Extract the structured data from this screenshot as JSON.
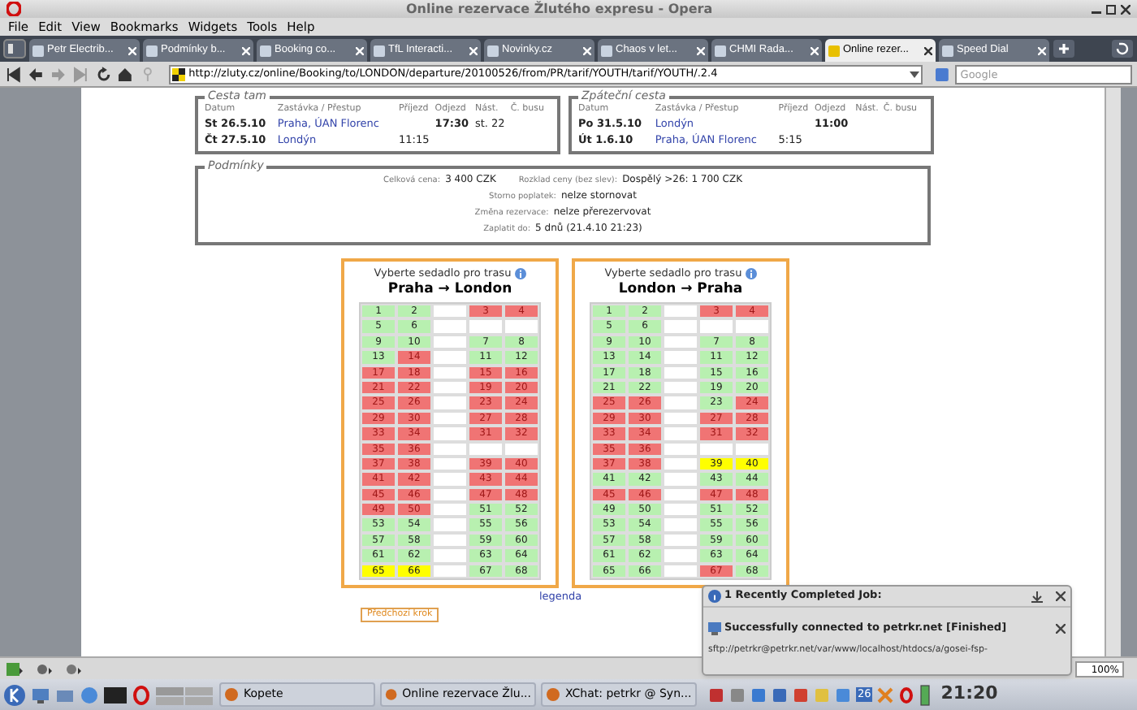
{
  "window": {
    "title": "Online rezervace Žlutého expresu - Opera"
  },
  "menu": [
    "File",
    "Edit",
    "View",
    "Bookmarks",
    "Widgets",
    "Tools",
    "Help"
  ],
  "tabs": [
    {
      "label": "Petr Electrib...",
      "selected": false
    },
    {
      "label": "Podmínky b...",
      "selected": false
    },
    {
      "label": "Booking co...",
      "selected": false
    },
    {
      "label": "TfL Interacti...",
      "selected": false
    },
    {
      "label": "Novinky.cz",
      "selected": false
    },
    {
      "label": "Chaos v let...",
      "selected": false
    },
    {
      "label": "CHMI Rada...",
      "selected": false
    },
    {
      "label": "Online rezer...",
      "selected": true
    },
    {
      "label": "Speed Dial",
      "selected": false
    }
  ],
  "address_bar": {
    "url": "http://zluty.cz/online/Booking/to/LONDON/departure/20100526/from/PR/tarif/YOUTH/tarif/YOUTH/.2.4"
  },
  "search": {
    "placeholder": "Google"
  },
  "trips": [
    {
      "title": "Cesta tam",
      "columns": [
        "Datum",
        "Zastávka / Přestup",
        "Příjezd",
        "Odjezd",
        "Nást.",
        "Č. busu"
      ],
      "rows": [
        {
          "date": "St 26.5.10",
          "stop": "Praha, ÚAN Florenc",
          "departure": "17:30",
          "platform": "st. 22"
        },
        {
          "date": "Čt 27.5.10",
          "stop": "Londýn",
          "arrival": "11:15"
        }
      ]
    },
    {
      "title": "Zpáteční cesta",
      "columns": [
        "Datum",
        "Zastávka / Přestup",
        "Příjezd",
        "Odjezd",
        "Nást.",
        "Č. busu"
      ],
      "rows": [
        {
          "date": "Po 31.5.10",
          "stop": "Londýn",
          "departure": "11:00"
        },
        {
          "date": "Út 1.6.10",
          "stop": "Praha, ÚAN Florenc",
          "arrival": "5:15"
        }
      ]
    }
  ],
  "conditions": {
    "title": "Podmínky",
    "lines": [
      [
        {
          "label": "Celková cena:",
          "value": "3 400 CZK"
        },
        {
          "label": "Rozklad ceny (bez slev):",
          "value": "Dospělý >26: 1 700 CZK"
        }
      ],
      [
        {
          "label": "Storno poplatek:",
          "value": "nelze stornovat"
        }
      ],
      [
        {
          "label": "Změna rezervace:",
          "value": "nelze přerezervovat"
        }
      ],
      [
        {
          "label": "Zaplatit do:",
          "value": "5 dnů (21.4.10 21:23)"
        }
      ]
    ]
  },
  "seat_maps": [
    {
      "heading": "Vyberte sedadlo pro trasu",
      "route": "Praha → London",
      "rows": [
        [
          {
            "kind": "seat",
            "number": "1",
            "taken": false,
            "selected": false
          },
          {
            "kind": "seat",
            "number": "2",
            "taken": false,
            "selected": false
          },
          {
            "kind": "seat",
            "number": "3",
            "taken": true,
            "selected": false
          },
          {
            "kind": "seat",
            "number": "4",
            "taken": true,
            "selected": false
          }
        ],
        [
          {
            "kind": "seat",
            "number": "5",
            "taken": false,
            "selected": false
          },
          {
            "kind": "seat",
            "number": "6",
            "taken": false,
            "selected": false
          },
          {
            "kind": "gap"
          },
          {
            "kind": "gap"
          }
        ],
        [
          {
            "kind": "seat",
            "number": "9",
            "taken": false,
            "selected": false
          },
          {
            "kind": "seat",
            "number": "10",
            "taken": false,
            "selected": false
          },
          {
            "kind": "seat",
            "number": "7",
            "taken": false,
            "selected": false
          },
          {
            "kind": "seat",
            "number": "8",
            "taken": false,
            "selected": false
          }
        ],
        [
          {
            "kind": "seat",
            "number": "13",
            "taken": false,
            "selected": false
          },
          {
            "kind": "seat",
            "number": "14",
            "taken": true,
            "selected": false
          },
          {
            "kind": "seat",
            "number": "11",
            "taken": false,
            "selected": false
          },
          {
            "kind": "seat",
            "number": "12",
            "taken": false,
            "selected": false
          }
        ],
        [
          {
            "kind": "seat",
            "number": "17",
            "taken": true,
            "selected": false
          },
          {
            "kind": "seat",
            "number": "18",
            "taken": true,
            "selected": false
          },
          {
            "kind": "seat",
            "number": "15",
            "taken": true,
            "selected": false
          },
          {
            "kind": "seat",
            "number": "16",
            "taken": true,
            "selected": false
          }
        ],
        [
          {
            "kind": "seat",
            "number": "21",
            "taken": true,
            "selected": false
          },
          {
            "kind": "seat",
            "number": "22",
            "taken": true,
            "selected": false
          },
          {
            "kind": "seat",
            "number": "19",
            "taken": true,
            "selected": false
          },
          {
            "kind": "seat",
            "number": "20",
            "taken": true,
            "selected": false
          }
        ],
        [
          {
            "kind": "seat",
            "number": "25",
            "taken": true,
            "selected": false
          },
          {
            "kind": "seat",
            "number": "26",
            "taken": true,
            "selected": false
          },
          {
            "kind": "seat",
            "number": "23",
            "taken": true,
            "selected": false
          },
          {
            "kind": "seat",
            "number": "24",
            "taken": true,
            "selected": false
          }
        ],
        [
          {
            "kind": "seat",
            "number": "29",
            "taken": true,
            "selected": false
          },
          {
            "kind": "seat",
            "number": "30",
            "taken": true,
            "selected": false
          },
          {
            "kind": "seat",
            "number": "27",
            "taken": true,
            "selected": false
          },
          {
            "kind": "seat",
            "number": "28",
            "taken": true,
            "selected": false
          }
        ],
        [
          {
            "kind": "seat",
            "number": "33",
            "taken": true,
            "selected": false
          },
          {
            "kind": "seat",
            "number": "34",
            "taken": true,
            "selected": false
          },
          {
            "kind": "seat",
            "number": "31",
            "taken": true,
            "selected": false
          },
          {
            "kind": "seat",
            "number": "32",
            "taken": true,
            "selected": false
          }
        ],
        [
          {
            "kind": "seat",
            "number": "35",
            "taken": true,
            "selected": false
          },
          {
            "kind": "seat",
            "number": "36",
            "taken": true,
            "selected": false
          },
          {
            "kind": "gap"
          },
          {
            "kind": "gap"
          }
        ],
        [
          {
            "kind": "seat",
            "number": "37",
            "taken": true,
            "selected": false
          },
          {
            "kind": "seat",
            "number": "38",
            "taken": true,
            "selected": false
          },
          {
            "kind": "seat",
            "number": "39",
            "taken": true,
            "selected": false
          },
          {
            "kind": "seat",
            "number": "40",
            "taken": true,
            "selected": false
          }
        ],
        [
          {
            "kind": "seat",
            "number": "41",
            "taken": true,
            "selected": false
          },
          {
            "kind": "seat",
            "number": "42",
            "taken": true,
            "selected": false
          },
          {
            "kind": "seat",
            "number": "43",
            "taken": true,
            "selected": false
          },
          {
            "kind": "seat",
            "number": "44",
            "taken": true,
            "selected": false
          }
        ],
        [
          {
            "kind": "seat",
            "number": "45",
            "taken": true,
            "selected": false
          },
          {
            "kind": "seat",
            "number": "46",
            "taken": true,
            "selected": false
          },
          {
            "kind": "seat",
            "number": "47",
            "taken": true,
            "selected": false
          },
          {
            "kind": "seat",
            "number": "48",
            "taken": true,
            "selected": false
          }
        ],
        [
          {
            "kind": "seat",
            "number": "49",
            "taken": true,
            "selected": false
          },
          {
            "kind": "seat",
            "number": "50",
            "taken": true,
            "selected": false
          },
          {
            "kind": "seat",
            "number": "51",
            "taken": false,
            "selected": false
          },
          {
            "kind": "seat",
            "number": "52",
            "taken": false,
            "selected": false
          }
        ],
        [
          {
            "kind": "seat",
            "number": "53",
            "taken": false,
            "selected": false
          },
          {
            "kind": "seat",
            "number": "54",
            "taken": false,
            "selected": false
          },
          {
            "kind": "seat",
            "number": "55",
            "taken": false,
            "selected": false
          },
          {
            "kind": "seat",
            "number": "56",
            "taken": false,
            "selected": false
          }
        ],
        [
          {
            "kind": "seat",
            "number": "57",
            "taken": false,
            "selected": false
          },
          {
            "kind": "seat",
            "number": "58",
            "taken": false,
            "selected": false
          },
          {
            "kind": "seat",
            "number": "59",
            "taken": false,
            "selected": false
          },
          {
            "kind": "seat",
            "number": "60",
            "taken": false,
            "selected": false
          }
        ],
        [
          {
            "kind": "seat",
            "number": "61",
            "taken": false,
            "selected": false
          },
          {
            "kind": "seat",
            "number": "62",
            "taken": false,
            "selected": false
          },
          {
            "kind": "seat",
            "number": "63",
            "taken": false,
            "selected": false
          },
          {
            "kind": "seat",
            "number": "64",
            "taken": false,
            "selected": false
          }
        ],
        [
          {
            "kind": "seat",
            "number": "65",
            "taken": false,
            "selected": true
          },
          {
            "kind": "seat",
            "number": "66",
            "taken": false,
            "selected": true
          },
          {
            "kind": "seat",
            "number": "67",
            "taken": false,
            "selected": false
          },
          {
            "kind": "seat",
            "number": "68",
            "taken": false,
            "selected": false
          }
        ]
      ]
    },
    {
      "heading": "Vyberte sedadlo pro trasu",
      "route": "London → Praha",
      "rows": [
        [
          {
            "kind": "seat",
            "number": "1",
            "taken": false,
            "selected": false
          },
          {
            "kind": "seat",
            "number": "2",
            "taken": false,
            "selected": false
          },
          {
            "kind": "seat",
            "number": "3",
            "taken": true,
            "selected": false
          },
          {
            "kind": "seat",
            "number": "4",
            "taken": true,
            "selected": false
          }
        ],
        [
          {
            "kind": "seat",
            "number": "5",
            "taken": false,
            "selected": false
          },
          {
            "kind": "seat",
            "number": "6",
            "taken": false,
            "selected": false
          },
          {
            "kind": "gap"
          },
          {
            "kind": "gap"
          }
        ],
        [
          {
            "kind": "seat",
            "number": "9",
            "taken": false,
            "selected": false
          },
          {
            "kind": "seat",
            "number": "10",
            "taken": false,
            "selected": false
          },
          {
            "kind": "seat",
            "number": "7",
            "taken": false,
            "selected": false
          },
          {
            "kind": "seat",
            "number": "8",
            "taken": false,
            "selected": false
          }
        ],
        [
          {
            "kind": "seat",
            "number": "13",
            "taken": false,
            "selected": false
          },
          {
            "kind": "seat",
            "number": "14",
            "taken": false,
            "selected": false
          },
          {
            "kind": "seat",
            "number": "11",
            "taken": false,
            "selected": false
          },
          {
            "kind": "seat",
            "number": "12",
            "taken": false,
            "selected": false
          }
        ],
        [
          {
            "kind": "seat",
            "number": "17",
            "taken": false,
            "selected": false
          },
          {
            "kind": "seat",
            "number": "18",
            "taken": false,
            "selected": false
          },
          {
            "kind": "seat",
            "number": "15",
            "taken": false,
            "selected": false
          },
          {
            "kind": "seat",
            "number": "16",
            "taken": false,
            "selected": false
          }
        ],
        [
          {
            "kind": "seat",
            "number": "21",
            "taken": false,
            "selected": false
          },
          {
            "kind": "seat",
            "number": "22",
            "taken": false,
            "selected": false
          },
          {
            "kind": "seat",
            "number": "19",
            "taken": false,
            "selected": false
          },
          {
            "kind": "seat",
            "number": "20",
            "taken": false,
            "selected": false
          }
        ],
        [
          {
            "kind": "seat",
            "number": "25",
            "taken": true,
            "selected": false
          },
          {
            "kind": "seat",
            "number": "26",
            "taken": true,
            "selected": false
          },
          {
            "kind": "seat",
            "number": "23",
            "taken": false,
            "selected": false
          },
          {
            "kind": "seat",
            "number": "24",
            "taken": true,
            "selected": false
          }
        ],
        [
          {
            "kind": "seat",
            "number": "29",
            "taken": true,
            "selected": false
          },
          {
            "kind": "seat",
            "number": "30",
            "taken": true,
            "selected": false
          },
          {
            "kind": "seat",
            "number": "27",
            "taken": true,
            "selected": false
          },
          {
            "kind": "seat",
            "number": "28",
            "taken": true,
            "selected": false
          }
        ],
        [
          {
            "kind": "seat",
            "number": "33",
            "taken": true,
            "selected": false
          },
          {
            "kind": "seat",
            "number": "34",
            "taken": true,
            "selected": false
          },
          {
            "kind": "seat",
            "number": "31",
            "taken": true,
            "selected": false
          },
          {
            "kind": "seat",
            "number": "32",
            "taken": true,
            "selected": false
          }
        ],
        [
          {
            "kind": "seat",
            "number": "35",
            "taken": true,
            "selected": false
          },
          {
            "kind": "seat",
            "number": "36",
            "taken": true,
            "selected": false
          },
          {
            "kind": "gap"
          },
          {
            "kind": "gap"
          }
        ],
        [
          {
            "kind": "seat",
            "number": "37",
            "taken": true,
            "selected": false
          },
          {
            "kind": "seat",
            "number": "38",
            "taken": true,
            "selected": false
          },
          {
            "kind": "seat",
            "number": "39",
            "taken": false,
            "selected": true
          },
          {
            "kind": "seat",
            "number": "40",
            "taken": false,
            "selected": true
          }
        ],
        [
          {
            "kind": "seat",
            "number": "41",
            "taken": false,
            "selected": false
          },
          {
            "kind": "seat",
            "number": "42",
            "taken": false,
            "selected": false
          },
          {
            "kind": "seat",
            "number": "43",
            "taken": false,
            "selected": false
          },
          {
            "kind": "seat",
            "number": "44",
            "taken": false,
            "selected": false
          }
        ],
        [
          {
            "kind": "seat",
            "number": "45",
            "taken": true,
            "selected": false
          },
          {
            "kind": "seat",
            "number": "46",
            "taken": true,
            "selected": false
          },
          {
            "kind": "seat",
            "number": "47",
            "taken": true,
            "selected": false
          },
          {
            "kind": "seat",
            "number": "48",
            "taken": true,
            "selected": false
          }
        ],
        [
          {
            "kind": "seat",
            "number": "49",
            "taken": false,
            "selected": false
          },
          {
            "kind": "seat",
            "number": "50",
            "taken": false,
            "selected": false
          },
          {
            "kind": "seat",
            "number": "51",
            "taken": false,
            "selected": false
          },
          {
            "kind": "seat",
            "number": "52",
            "taken": false,
            "selected": false
          }
        ],
        [
          {
            "kind": "seat",
            "number": "53",
            "taken": false,
            "selected": false
          },
          {
            "kind": "seat",
            "number": "54",
            "taken": false,
            "selected": false
          },
          {
            "kind": "seat",
            "number": "55",
            "taken": false,
            "selected": false
          },
          {
            "kind": "seat",
            "number": "56",
            "taken": false,
            "selected": false
          }
        ],
        [
          {
            "kind": "seat",
            "number": "57",
            "taken": false,
            "selected": false
          },
          {
            "kind": "seat",
            "number": "58",
            "taken": false,
            "selected": false
          },
          {
            "kind": "seat",
            "number": "59",
            "taken": false,
            "selected": false
          },
          {
            "kind": "seat",
            "number": "60",
            "taken": false,
            "selected": false
          }
        ],
        [
          {
            "kind": "seat",
            "number": "61",
            "taken": false,
            "selected": false
          },
          {
            "kind": "seat",
            "number": "62",
            "taken": false,
            "selected": false
          },
          {
            "kind": "seat",
            "number": "63",
            "taken": false,
            "selected": false
          },
          {
            "kind": "seat",
            "number": "64",
            "taken": false,
            "selected": false
          }
        ],
        [
          {
            "kind": "seat",
            "number": "65",
            "taken": false,
            "selected": false
          },
          {
            "kind": "seat",
            "number": "66",
            "taken": false,
            "selected": false
          },
          {
            "kind": "seat",
            "number": "67",
            "taken": true,
            "selected": false
          },
          {
            "kind": "seat",
            "number": "68",
            "taken": false,
            "selected": false
          }
        ]
      ]
    }
  ],
  "legend_link": "legenda",
  "back_button": "Předchozí krok",
  "status_bar": {
    "zoom": "100%"
  },
  "notification": {
    "title": "1 Recently Completed Job:",
    "job": "Successfully connected to petrkr.net [Finished]",
    "path": "sftp://petrkr@petrkr.net/var/www/localhost/htdocs/a/gosei-fsp-"
  },
  "taskbar": {
    "tasks": [
      "Kopete",
      "Online rezervace Žlu...",
      "XChat: petrkr @ Syn..."
    ],
    "tray_badge": "26",
    "clock": "21:20"
  }
}
